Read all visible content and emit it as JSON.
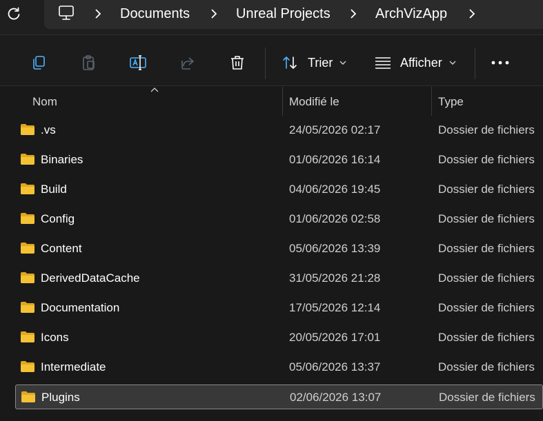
{
  "address": {
    "crumbs": [
      "Documents",
      "Unreal Projects",
      "ArchVizApp"
    ]
  },
  "toolbar": {
    "sort_label": "Trier",
    "view_label": "Afficher",
    "icons": [
      "copy-icon",
      "paste-icon",
      "rename-icon",
      "share-icon",
      "delete-icon",
      "sort-icon",
      "view-icon",
      "more-icon"
    ]
  },
  "columns": {
    "name": "Nom",
    "modified": "Modifié le",
    "type": "Type"
  },
  "files": [
    {
      "name": ".vs",
      "modified": "24/05/2026 02:17",
      "type": "Dossier de fichiers"
    },
    {
      "name": "Binaries",
      "modified": "01/06/2026 16:14",
      "type": "Dossier de fichiers"
    },
    {
      "name": "Build",
      "modified": "04/06/2026 19:45",
      "type": "Dossier de fichiers"
    },
    {
      "name": "Config",
      "modified": "01/06/2026 02:58",
      "type": "Dossier de fichiers"
    },
    {
      "name": "Content",
      "modified": "05/06/2026 13:39",
      "type": "Dossier de fichiers"
    },
    {
      "name": "DerivedDataCache",
      "modified": "31/05/2026 21:28",
      "type": "Dossier de fichiers"
    },
    {
      "name": "Documentation",
      "modified": "17/05/2026 12:14",
      "type": "Dossier de fichiers"
    },
    {
      "name": "Icons",
      "modified": "20/05/2026 17:01",
      "type": "Dossier de fichiers"
    },
    {
      "name": "Intermediate",
      "modified": "05/06/2026 13:37",
      "type": "Dossier de fichiers"
    },
    {
      "name": "Plugins",
      "modified": "02/06/2026 13:07",
      "type": "Dossier de fichiers",
      "selected": true
    }
  ],
  "colors": {
    "folder": "#f4c233",
    "background": "#191919",
    "selection": "#383838"
  }
}
